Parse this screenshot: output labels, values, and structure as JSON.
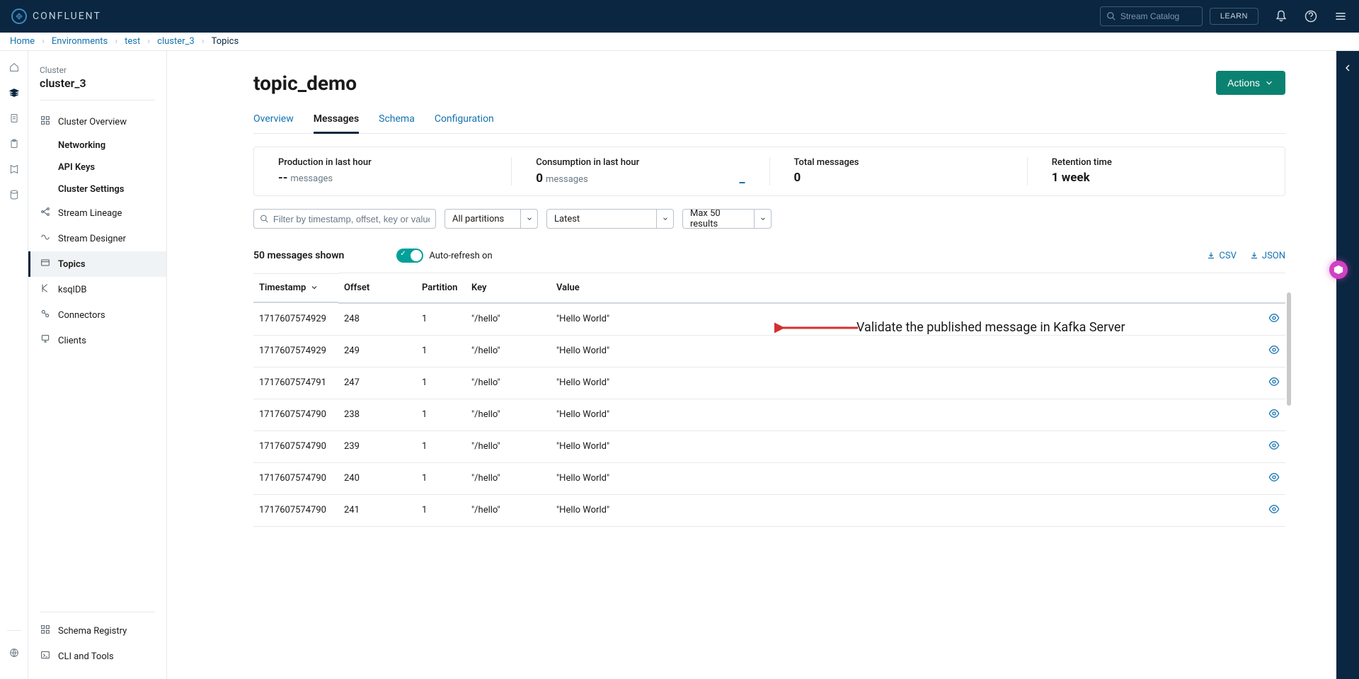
{
  "header": {
    "brand": "CONFLUENT",
    "search_placeholder": "Stream Catalog",
    "learn_label": "LEARN"
  },
  "breadcrumbs": [
    {
      "label": "Home",
      "current": false
    },
    {
      "label": "Environments",
      "current": false
    },
    {
      "label": "test",
      "current": false
    },
    {
      "label": "cluster_3",
      "current": false
    },
    {
      "label": "Topics",
      "current": true
    }
  ],
  "sidebar": {
    "label": "Cluster",
    "title": "cluster_3",
    "items": [
      {
        "label": "Cluster Overview",
        "icon": "grid",
        "active": false
      },
      {
        "label": "Networking",
        "sub": true,
        "active": false
      },
      {
        "label": "API Keys",
        "sub": true,
        "active": false
      },
      {
        "label": "Cluster Settings",
        "sub": true,
        "active": false
      },
      {
        "label": "Stream Lineage",
        "icon": "lineage",
        "active": false
      },
      {
        "label": "Stream Designer",
        "icon": "designer",
        "active": false
      },
      {
        "label": "Topics",
        "icon": "topics",
        "active": true
      },
      {
        "label": "ksqlDB",
        "icon": "ksql",
        "active": false
      },
      {
        "label": "Connectors",
        "icon": "connectors",
        "active": false
      },
      {
        "label": "Clients",
        "icon": "clients",
        "active": false
      }
    ],
    "bottom_items": [
      {
        "label": "Schema Registry",
        "icon": "schema"
      },
      {
        "label": "CLI and Tools",
        "icon": "cli"
      }
    ]
  },
  "page": {
    "title": "topic_demo",
    "actions_label": "Actions"
  },
  "tabs": [
    {
      "label": "Overview",
      "active": false
    },
    {
      "label": "Messages",
      "active": true
    },
    {
      "label": "Schema",
      "active": false
    },
    {
      "label": "Configuration",
      "active": false
    }
  ],
  "stats": {
    "production_label": "Production in last hour",
    "production_value": "--",
    "production_unit": "messages",
    "consumption_label": "Consumption in last hour",
    "consumption_value": "0",
    "consumption_unit": "messages",
    "consumption_marker": "_",
    "total_label": "Total messages",
    "total_value": "0",
    "retention_label": "Retention time",
    "retention_value": "1 week"
  },
  "filters": {
    "search_placeholder": "Filter by timestamp, offset, key or value",
    "partition_label": "All partitions",
    "offset_label": "Latest",
    "max_label": "Max 50 results"
  },
  "controls": {
    "shown_text": "50 messages shown",
    "auto_refresh_label": "Auto-refresh on",
    "csv_label": "CSV",
    "json_label": "JSON"
  },
  "table": {
    "headers": {
      "timestamp": "Timestamp",
      "offset": "Offset",
      "partition": "Partition",
      "key": "Key",
      "value": "Value"
    },
    "rows": [
      {
        "timestamp": "1717607574929",
        "offset": "248",
        "partition": "1",
        "key": "\"/hello\"",
        "value": "\"Hello World\""
      },
      {
        "timestamp": "1717607574929",
        "offset": "249",
        "partition": "1",
        "key": "\"/hello\"",
        "value": "\"Hello World\""
      },
      {
        "timestamp": "1717607574791",
        "offset": "247",
        "partition": "1",
        "key": "\"/hello\"",
        "value": "\"Hello World\""
      },
      {
        "timestamp": "1717607574790",
        "offset": "238",
        "partition": "1",
        "key": "\"/hello\"",
        "value": "\"Hello World\""
      },
      {
        "timestamp": "1717607574790",
        "offset": "239",
        "partition": "1",
        "key": "\"/hello\"",
        "value": "\"Hello World\""
      },
      {
        "timestamp": "1717607574790",
        "offset": "240",
        "partition": "1",
        "key": "\"/hello\"",
        "value": "\"Hello World\""
      },
      {
        "timestamp": "1717607574790",
        "offset": "241",
        "partition": "1",
        "key": "\"/hello\"",
        "value": "\"Hello World\""
      }
    ]
  },
  "annotation": {
    "text": "Validate the published message in Kafka Server"
  }
}
